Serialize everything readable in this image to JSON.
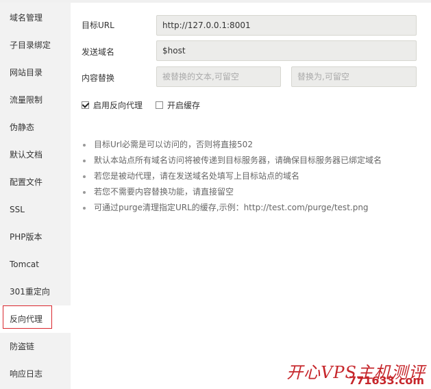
{
  "sidebar": {
    "items": [
      {
        "label": "域名管理"
      },
      {
        "label": "子目录绑定"
      },
      {
        "label": "网站目录"
      },
      {
        "label": "流量限制"
      },
      {
        "label": "伪静态"
      },
      {
        "label": "默认文档"
      },
      {
        "label": "配置文件"
      },
      {
        "label": "SSL"
      },
      {
        "label": "PHP版本"
      },
      {
        "label": "Tomcat"
      },
      {
        "label": "301重定向"
      },
      {
        "label": "反向代理"
      },
      {
        "label": "防盗链"
      },
      {
        "label": "响应日志"
      }
    ],
    "active": "反向代理"
  },
  "form": {
    "target_url_label": "目标URL",
    "target_url_value": "http://127.0.0.1:8001",
    "send_domain_label": "发送域名",
    "send_domain_value": "$host",
    "replace_label": "内容替换",
    "replace_from_placeholder": "被替换的文本,可留空",
    "replace_to_placeholder": "替换为,可留空",
    "enable_proxy_label": "启用反向代理",
    "enable_proxy_checked": true,
    "enable_cache_label": "开启缓存",
    "enable_cache_checked": false
  },
  "tips": [
    "目标Url必需是可以访问的，否则将直接502",
    "默认本站点所有域名访问将被传递到目标服务器，请确保目标服务器已绑定域名",
    "若您是被动代理，请在发送域名处填写上目标站点的域名",
    "若您不需要内容替换功能，请直接留空",
    "可通过purge清理指定URL的缓存,示例：http://test.com/purge/test.png"
  ],
  "watermark": {
    "title": "开心VPS主机测评",
    "site": "771633.com"
  }
}
